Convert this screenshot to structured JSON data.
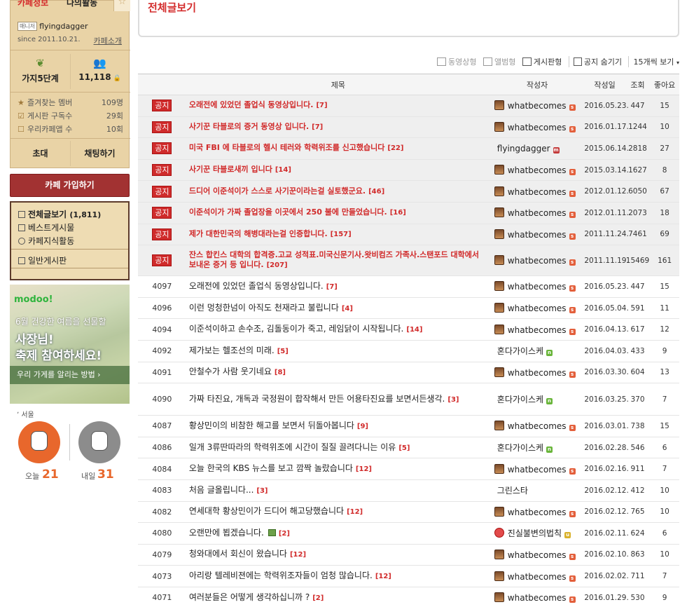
{
  "cafe": {
    "tab_info": "카페정보",
    "tab_activity": "나의활동",
    "manager_badge": "매니저",
    "manager_name": "flyingdagger",
    "since": "since 2011.10.21.",
    "intro_link": "카페소개",
    "level_label": "가지5단계",
    "member_count": "11,118",
    "stats": [
      {
        "label": "즐겨찾는 멤버",
        "value": "109명",
        "icon": "star-icon"
      },
      {
        "label": "게시판 구독수",
        "value": "29회",
        "icon": "check-icon"
      },
      {
        "label": "우리카페앱 수",
        "value": "10회",
        "icon": "box-icon"
      }
    ],
    "invite_button": "초대",
    "chat_button": "채팅하기",
    "join_button": "카페 가입하기"
  },
  "menu": {
    "all_posts": "전체글보기",
    "all_posts_count": "(1,811)",
    "best": "베스트게시물",
    "knowledge": "카페지식활동",
    "general": "일반게시판"
  },
  "ad": {
    "logo": "modoo!",
    "line1": "6월 건강한 여름을 선물할",
    "line2": "사장님!",
    "line3": "축제 참여하세요!",
    "line4": "우리 가게를 알리는 방법 ›"
  },
  "weather": {
    "city": "서울",
    "today_label": "오늘",
    "today_temp": "21",
    "tomorrow_label": "내일",
    "tomorrow_temp": "31"
  },
  "page": {
    "title": "전체글보기"
  },
  "view_options": {
    "video": "동영상형",
    "album": "앨범형",
    "board": "게시판형",
    "hide_notice": "공지 숨기기",
    "per_page": "15개씩 보기"
  },
  "table": {
    "headers": {
      "title": "제목",
      "author": "작성자",
      "date": "작성일",
      "views": "조회",
      "likes": "좋아요"
    },
    "notice_label": "공지",
    "notices": [
      {
        "title": "오래전에 있었던 졸업식 동영상입니다.",
        "comments": "[7]",
        "author": "whatbecomes",
        "date": "2016.05.23.",
        "views": "447",
        "likes": "15"
      },
      {
        "title": "사기꾼 타블로의 증거 동영상 입니다.",
        "comments": "[7]",
        "author": "whatbecomes",
        "date": "2016.01.17.",
        "views": "1244",
        "likes": "10"
      },
      {
        "title": "미국 FBI 에 타블로의 헬시 테러와 학력위조를 신고했습니다",
        "comments": "[22]",
        "author": "flyingdagger",
        "date": "2015.06.14.",
        "views": "2818",
        "likes": "27"
      },
      {
        "title": "사기꾼 타블로새끼 입니다",
        "comments": "[14]",
        "author": "whatbecomes",
        "date": "2015.03.14.",
        "views": "1627",
        "likes": "8"
      },
      {
        "title": "드디어 이준석이가 스스로 사기꾼이라는걸 실토했군요.",
        "comments": "[46]",
        "author": "whatbecomes",
        "date": "2012.01.12.",
        "views": "6050",
        "likes": "67"
      },
      {
        "title": "이준석이가 가짜 졸업장을 이곳에서 250 불에 만들었습니다.",
        "comments": "[16]",
        "author": "whatbecomes",
        "date": "2012.01.11.",
        "views": "2073",
        "likes": "18"
      },
      {
        "title": "제가 대한민국의 해병대라는걸 인증합니다.",
        "comments": "[157]",
        "author": "whatbecomes",
        "date": "2011.11.24.",
        "views": "7461",
        "likes": "69"
      },
      {
        "title": "잔스 합킨스 대학의 합격증.고교 성적표.미국신문기사.왓비컴즈 가족사.스탠포드 대학에서 보내온 증거 등 입니다.",
        "comments": "[207]",
        "author": "whatbecomes",
        "date": "2011.11.19.",
        "views": "15469",
        "likes": "161"
      }
    ],
    "posts": [
      {
        "no": "4097",
        "title": "오래전에 있었던 졸업식 동영상입니다.",
        "comments": "[7]",
        "author": "whatbecomes",
        "avatar": "whatbecomes",
        "level": "o",
        "date": "2016.05.23.",
        "views": "447",
        "likes": "15"
      },
      {
        "no": "4096",
        "title": "이런 멍청한넘이 아직도 천재라고 불립니다",
        "comments": "[4]",
        "author": "whatbecomes",
        "avatar": "whatbecomes",
        "level": "o",
        "date": "2016.05.04.",
        "views": "591",
        "likes": "11"
      },
      {
        "no": "4094",
        "title": "이준석이하고 손수조, 김돌동이가 죽고, 레임닭이 시작됩니다.",
        "comments": "[14]",
        "author": "whatbecomes",
        "avatar": "whatbecomes",
        "level": "o",
        "date": "2016.04.13.",
        "views": "617",
        "likes": "12"
      },
      {
        "no": "4092",
        "title": "제가보는 헬조선의 미래.",
        "comments": "[5]",
        "author": "혼다가이스케",
        "avatar": "",
        "level": "g",
        "date": "2016.04.03.",
        "views": "433",
        "likes": "9"
      },
      {
        "no": "4091",
        "title": "안철수가 사람 웃기네요",
        "comments": "[8]",
        "author": "whatbecomes",
        "avatar": "whatbecomes",
        "level": "o",
        "date": "2016.03.30.",
        "views": "604",
        "likes": "13"
      },
      {
        "no": "4090",
        "title": "가짜 타진요, 개독과 국정원이 합작해서 만든 어용타진요를 보면서든생각.",
        "comments": "[3]",
        "author": "혼다가이스케",
        "avatar": "",
        "level": "g",
        "date": "2016.03.25.",
        "views": "370",
        "likes": "7"
      },
      {
        "no": "4087",
        "title": "황상민이의 비참한 해고를 보면서 뒤돌아봅니다",
        "comments": "[9]",
        "author": "whatbecomes",
        "avatar": "whatbecomes",
        "level": "o",
        "date": "2016.03.01.",
        "views": "738",
        "likes": "15"
      },
      {
        "no": "4086",
        "title": "일개 3류딴따라의 학력위조에 시간이 질질 끌려다니는 이유",
        "comments": "[5]",
        "author": "혼다가이스케",
        "avatar": "",
        "level": "g",
        "date": "2016.02.28.",
        "views": "546",
        "likes": "6"
      },
      {
        "no": "4084",
        "title": "오늘 한국의 KBS 뉴스를 보고 깜짝 놀랐습니다",
        "comments": "[12]",
        "author": "whatbecomes",
        "avatar": "whatbecomes",
        "level": "o",
        "date": "2016.02.16.",
        "views": "911",
        "likes": "7"
      },
      {
        "no": "4083",
        "title": "처음 글올립니다...",
        "comments": "[3]",
        "author": "그린스타",
        "avatar": "",
        "level": "",
        "date": "2016.02.12.",
        "views": "412",
        "likes": "10"
      },
      {
        "no": "4082",
        "title": "연세대학 황상민이가 드디어 해고당했습니다",
        "comments": "[12]",
        "author": "whatbecomes",
        "avatar": "whatbecomes",
        "level": "o",
        "date": "2016.02.12.",
        "views": "765",
        "likes": "10"
      },
      {
        "no": "4080",
        "title": "오랜만에 뵙겠습니다.",
        "comments": "[2]",
        "author": "진실불변의법칙",
        "avatar": "red",
        "level": "y",
        "date": "2016.02.11.",
        "views": "624",
        "likes": "6",
        "has_image": true
      },
      {
        "no": "4079",
        "title": "청와대에서 회신이 왔습니다",
        "comments": "[12]",
        "author": "whatbecomes",
        "avatar": "whatbecomes",
        "level": "o",
        "date": "2016.02.10.",
        "views": "863",
        "likes": "10"
      },
      {
        "no": "4073",
        "title": "아리랑 텔레비젼에는 학력위조자들이 엄청 많습니다.",
        "comments": "[12]",
        "author": "whatbecomes",
        "avatar": "whatbecomes",
        "level": "o",
        "date": "2016.02.02.",
        "views": "711",
        "likes": "7"
      },
      {
        "no": "4071",
        "title": "여러분들은 어떻게 생각하십니까 ?",
        "comments": "[2]",
        "author": "whatbecomes",
        "avatar": "whatbecomes",
        "level": "o",
        "date": "2016.01.29.",
        "views": "530",
        "likes": "9"
      }
    ]
  }
}
